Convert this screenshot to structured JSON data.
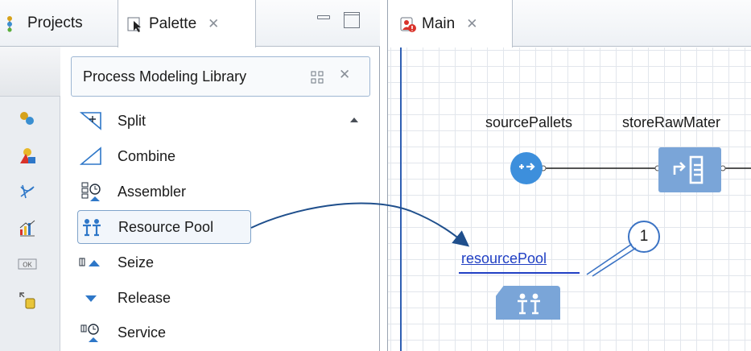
{
  "left_panel": {
    "tabs": [
      {
        "label": "Projects",
        "icon": "projects-icon"
      },
      {
        "label": "Palette",
        "icon": "palette-icon",
        "active": true
      }
    ],
    "window_controls": [
      "minimize-icon",
      "maximize-icon"
    ]
  },
  "palette": {
    "categories": [
      "process-icon",
      "agent-icon",
      "space-markup-icon",
      "analysis-icon",
      "controls-icon",
      "pictures-icon"
    ],
    "library_title": "Process Modeling Library",
    "items": [
      {
        "label": "Split",
        "icon": "split-icon"
      },
      {
        "label": "Combine",
        "icon": "combine-icon"
      },
      {
        "label": "Assembler",
        "icon": "assembler-icon"
      },
      {
        "label": "Resource Pool",
        "icon": "resource-pool-icon",
        "selected": true
      },
      {
        "label": "Seize",
        "icon": "seize-icon"
      },
      {
        "label": "Release",
        "icon": "release-icon"
      },
      {
        "label": "Service",
        "icon": "service-icon"
      }
    ]
  },
  "editor": {
    "tab_label": "Main",
    "tab_icon": "agent-main-icon",
    "blocks": [
      {
        "label": "sourcePallets",
        "icon": "source-icon"
      },
      {
        "label": "storeRawMater",
        "icon": "store-icon"
      },
      {
        "label": "resourcePool",
        "icon": "resource-pool-icon"
      }
    ],
    "callout": "1"
  },
  "colors": {
    "accent": "#2f5fb3",
    "block_fill": "#7aa5d8",
    "source_fill": "#3d8fdc",
    "link_text": "#2140c4",
    "arrow": "#1f4f8c",
    "callout_border": "#3b73c4"
  }
}
